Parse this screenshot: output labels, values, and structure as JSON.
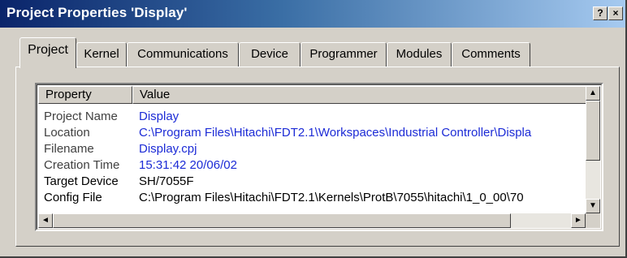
{
  "window": {
    "title": "Project Properties 'Display'",
    "help_label": "?",
    "close_label": "×"
  },
  "tabs": [
    {
      "label": "Project",
      "active": true
    },
    {
      "label": "Kernel"
    },
    {
      "label": "Communications"
    },
    {
      "label": "Device"
    },
    {
      "label": "Programmer"
    },
    {
      "label": "Modules"
    },
    {
      "label": "Comments"
    }
  ],
  "table": {
    "columns": [
      "Property",
      "Value"
    ],
    "rows": [
      {
        "property": "Project Name",
        "value": "Display"
      },
      {
        "property": "Location",
        "value": "C:\\Program Files\\Hitachi\\FDT2.1\\Workspaces\\Industrial Controller\\Displa"
      },
      {
        "property": "Filename",
        "value": "Display.cpj"
      },
      {
        "property": "Creation Time",
        "value": "15:31:42  20/06/02"
      },
      {
        "property": "Target Device",
        "value": "SH/7055F"
      },
      {
        "property": "Config File",
        "value": "C:\\Program Files\\Hitachi\\FDT2.1\\Kernels\\ProtB\\7055\\hitachi\\1_0_00\\70"
      }
    ]
  },
  "scroll": {
    "up_arrow": "▲",
    "down_arrow": "▼",
    "left_arrow": "◄",
    "right_arrow": "►"
  },
  "colors": {
    "value_text": "#1c2bd6",
    "title_gradient_start": "#0a246a",
    "title_gradient_end": "#a6caf0"
  }
}
